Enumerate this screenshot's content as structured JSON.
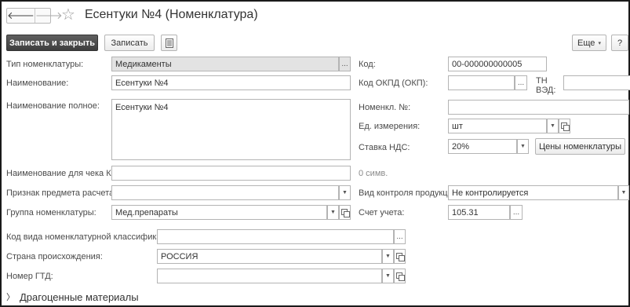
{
  "header": {
    "title": "Есентуки №4 (Номенклатура)",
    "back_icon": "arrow-left-icon",
    "forward_icon": "arrow-right-icon",
    "favorite_icon": "star-outline-icon"
  },
  "toolbar": {
    "save_close_label": "Записать и закрыть",
    "save_label": "Записать",
    "more_label": "Еще",
    "help_label": "?"
  },
  "fields": {
    "type_label": "Тип номенклатуры:",
    "type_value": "Медикаменты",
    "name_label": "Наименование:",
    "name_value": "Есентуки №4",
    "full_name_label": "Наименование полное:",
    "full_name_value": "Есентуки №4",
    "receipt_name_label": "Наименование для чека ККМ:",
    "receipt_name_value": "",
    "receipt_counter": "0 симв.",
    "payment_subject_label": "Признак предмета расчета:",
    "payment_subject_value": "",
    "group_label": "Группа номенклатуры:",
    "group_value": "Мед.препараты",
    "classification_label": "Код вида номенклатурной классификации:",
    "classification_value": "",
    "country_label": "Страна происхождения:",
    "country_value": "РОССИЯ",
    "gtd_label": "Номер ГТД:",
    "gtd_value": "",
    "code_label": "Код:",
    "code_value": "00-000000000005",
    "okpd_label": "Код ОКПД (ОКП):",
    "okpd_value": "",
    "tnved_label": "ТН ВЭД:",
    "tnved_value": "",
    "nomenkl_no_label": "Номенкл. №:",
    "nomenkl_no_value": "",
    "unit_label": "Ед. измерения:",
    "unit_value": "шт",
    "vat_label": "Ставка НДС:",
    "vat_value": "20%",
    "prices_button": "Цены номенклатуры",
    "control_label": "Вид контроля продукции:",
    "control_value": "Не контролируется",
    "account_label": "Счет учета:",
    "account_value": "105.31"
  },
  "section": {
    "precious_label": "Драгоценные материалы"
  },
  "glyphs": {
    "back": "🡐",
    "forward": "🡒",
    "star": "☆",
    "ellipsis": "...",
    "dropdown": "▼",
    "more_arrow": "▾",
    "expand": "〉"
  }
}
